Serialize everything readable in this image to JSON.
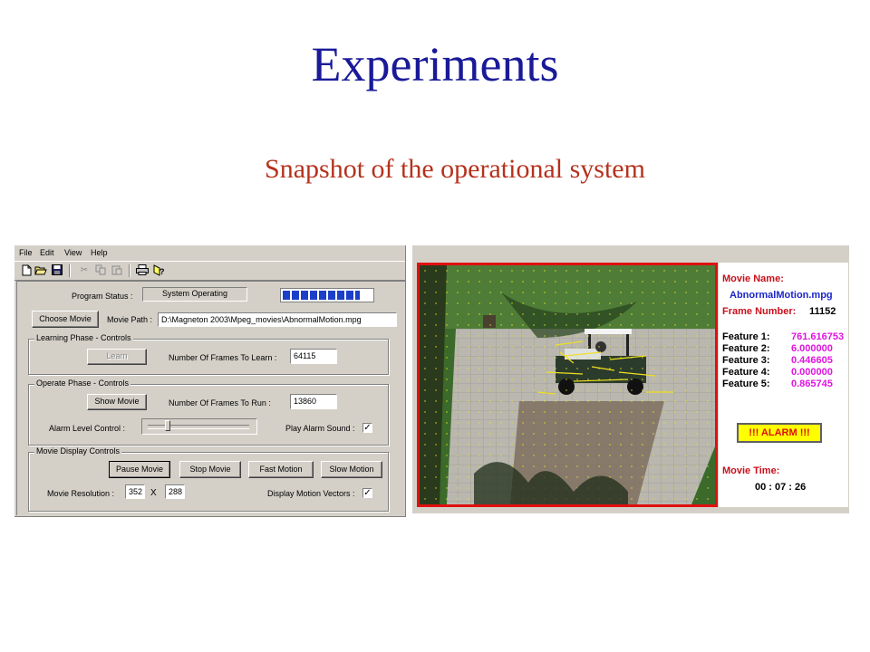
{
  "slide": {
    "title": "Experiments",
    "subtitle": "Snapshot of the operational system"
  },
  "app": {
    "menu": [
      "File",
      "Edit",
      "View",
      "Help"
    ],
    "toolbar_icons": [
      "new-file-icon",
      "open-folder-icon",
      "save-icon",
      "cut-icon",
      "copy-icon",
      "paste-icon",
      "print-icon",
      "help-icon"
    ],
    "program_status_label": "Program Status :",
    "program_status_value": "System Operating",
    "progress_fraction": 0.87,
    "choose_movie_button": "Choose Movie",
    "movie_path_label": "Movie Path :",
    "movie_path_value": "D:\\Magneton 2003\\Mpeg_movies\\AbnormalMotion.mpg",
    "learning": {
      "group_title": "Learning Phase - Controls",
      "learn_button": "Learn",
      "frames_label": "Number Of Frames To Learn :",
      "frames_value": "64115"
    },
    "operate": {
      "group_title": "Operate Phase - Controls",
      "show_movie_button": "Show Movie",
      "frames_label": "Number Of Frames To Run :",
      "frames_value": "13860",
      "alarm_level_label": "Alarm Level Control :",
      "alarm_level_fraction": 0.2,
      "play_alarm_label": "Play Alarm Sound :",
      "play_alarm_checked": "✓"
    },
    "display": {
      "group_title": "Movie Display Controls",
      "pause_button": "Pause Movie",
      "stop_button": "Stop Movie",
      "fast_button": "Fast Motion",
      "slow_button": "Slow Motion",
      "resolution_label": "Movie Resolution :",
      "width_value": "352",
      "times_symbol": "X",
      "height_value": "288",
      "motion_vectors_label": "Display Motion Vectors :",
      "motion_vectors_checked": "✓"
    }
  },
  "stats": {
    "movie_name_label": "Movie Name:",
    "movie_name_value": "AbnormalMotion.mpg",
    "frame_number_label": "Frame Number:",
    "frame_number_value": "11152",
    "features": [
      {
        "label": "Feature 1:",
        "value": "761.616753"
      },
      {
        "label": "Feature 2:",
        "value": "6.000000"
      },
      {
        "label": "Feature 3:",
        "value": "0.446605"
      },
      {
        "label": "Feature 4:",
        "value": "0.000000"
      },
      {
        "label": "Feature 5:",
        "value": "0.865745"
      }
    ],
    "alarm_text": "!!! ALARM !!!",
    "movie_time_label": "Movie Time:",
    "movie_time_value": "00 : 07 : 26"
  },
  "colors": {
    "title": "#1a1a99",
    "subtitle": "#b5321c",
    "video_border": "#e01010",
    "alarm_bg": "#ffff00",
    "progress_fill": "#1c3fc8"
  }
}
